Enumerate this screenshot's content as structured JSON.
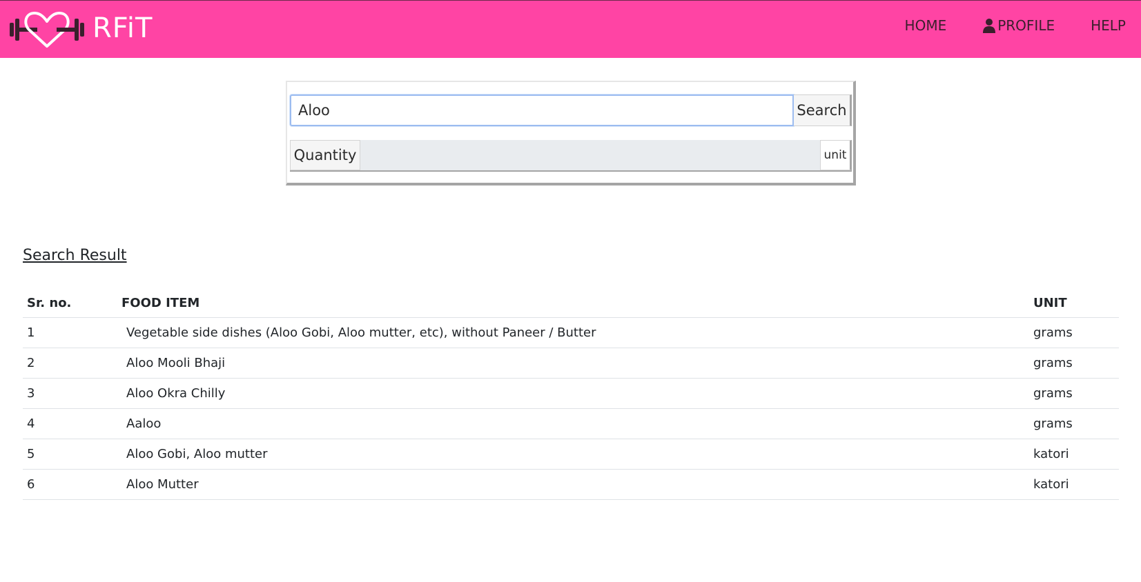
{
  "navbar": {
    "brand": "RFiT",
    "links": [
      {
        "label": "HOME"
      },
      {
        "label": "PROFILE"
      },
      {
        "label": "HELP"
      }
    ],
    "color": "#ff44a4"
  },
  "search": {
    "value": "Aloo",
    "button_label": "Search"
  },
  "quantity": {
    "label": "Quantity",
    "unit_label": "unit"
  },
  "results": {
    "title": "Search Result",
    "columns": [
      "Sr. no.",
      "FOOD ITEM",
      "UNIT"
    ],
    "rows": [
      {
        "sr": "1",
        "food": "Vegetable side dishes (Aloo Gobi, Aloo mutter, etc), without Paneer / Butter",
        "unit": "grams"
      },
      {
        "sr": "2",
        "food": "Aloo Mooli Bhaji",
        "unit": "grams"
      },
      {
        "sr": "3",
        "food": "Aloo Okra Chilly",
        "unit": "grams"
      },
      {
        "sr": "4",
        "food": "Aaloo",
        "unit": "grams"
      },
      {
        "sr": "5",
        "food": "Aloo Gobi, Aloo mutter",
        "unit": "katori"
      },
      {
        "sr": "6",
        "food": "Aloo Mutter",
        "unit": "katori"
      }
    ]
  },
  "icons": {
    "brand": "heart-dumbbell-logo-icon",
    "profile": "user-icon"
  }
}
